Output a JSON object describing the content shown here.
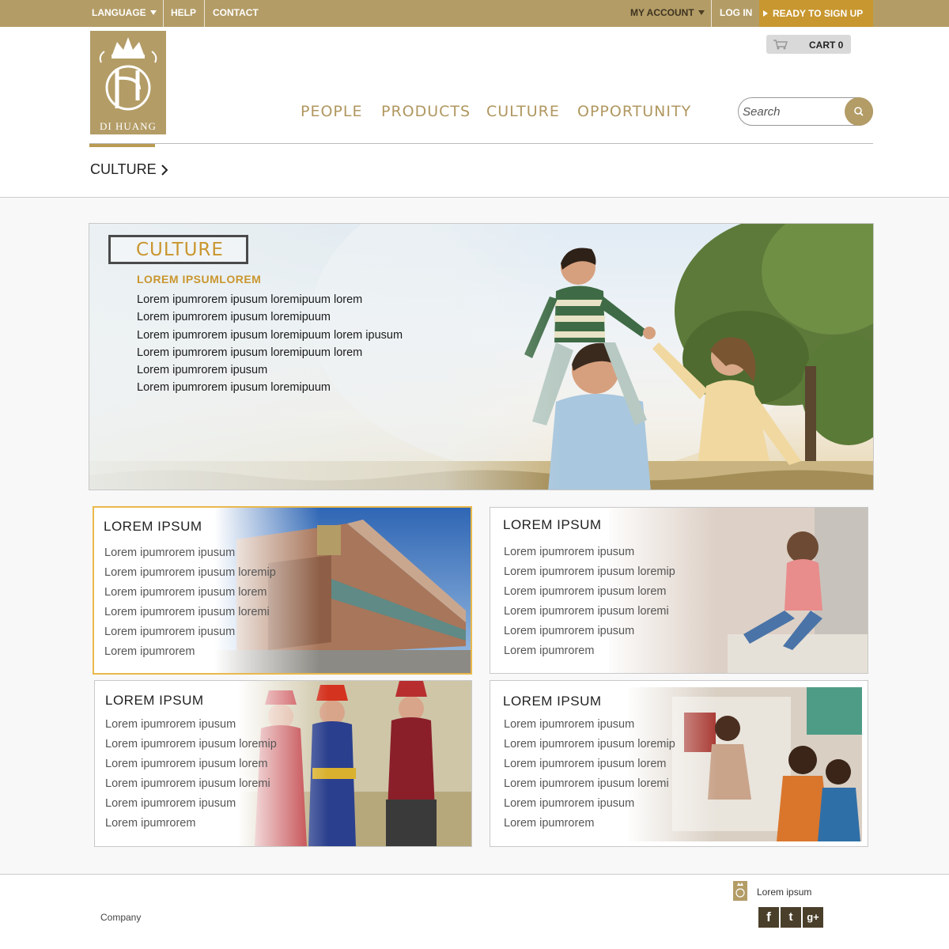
{
  "topbar": {
    "language": "LANGUAGE",
    "help": "HELP",
    "contact": "CONTACT",
    "my_account": "MY ACCOUNT",
    "login": "LOG IN",
    "signup": "READY TO SIGN UP"
  },
  "header": {
    "logo_text": "DI HUANG",
    "cart_label": "CART 0",
    "nav": [
      "PEOPLE",
      "PRODUCTS",
      "CULTURE",
      "OPPORTUNITY"
    ],
    "search_placeholder": "Search",
    "breadcrumb": "CULTURE"
  },
  "hero": {
    "title": "CULTURE",
    "subtitle": "LOREM IPSUMLOREM",
    "lines": [
      "Lorem ipumrorem ipusum loremipuum lorem",
      "Lorem ipumrorem ipusum loremipuum",
      "Lorem ipumrorem ipusum loremipuum lorem ipusum",
      "Lorem ipumrorem ipusum loremipuum lorem",
      "Lorem ipumrorem ipusum",
      "Lorem ipumrorem ipusum loremipuum"
    ]
  },
  "cards": [
    {
      "title": "LOREM IPSUM",
      "lines": [
        "Lorem ipumrorem ipusum",
        "Lorem ipumrorem ipusum loremip",
        "Lorem ipumrorem ipusum lorem",
        "Lorem ipumrorem ipusum loremi",
        "Lorem ipumrorem ipusum",
        "Lorem ipumrorem"
      ]
    },
    {
      "title": "LOREM IPSUM",
      "lines": [
        "Lorem ipumrorem ipusum",
        "Lorem ipumrorem ipusum loremip",
        "Lorem ipumrorem ipusum lorem",
        "Lorem ipumrorem ipusum loremi",
        "Lorem ipumrorem ipusum",
        "Lorem ipumrorem"
      ]
    },
    {
      "title": "LOREM IPSUM",
      "lines": [
        "Lorem ipumrorem ipusum",
        "Lorem ipumrorem ipusum loremip",
        "Lorem ipumrorem ipusum lorem",
        "Lorem ipumrorem ipusum loremi",
        "Lorem ipumrorem ipusum",
        "Lorem ipumrorem"
      ]
    },
    {
      "title": "LOREM IPSUM",
      "lines": [
        "Lorem ipumrorem ipusum",
        "Lorem ipumrorem ipusum loremip",
        "Lorem ipumrorem ipusum lorem",
        "Lorem ipumrorem ipusum loremi",
        "Lorem ipumrorem ipusum",
        "Lorem ipumrorem"
      ]
    }
  ],
  "footer": {
    "company": "Company",
    "text": "Lorem ipsum",
    "social": [
      "f",
      "t",
      "g+"
    ]
  },
  "colors": {
    "brand_gold": "#b39c66",
    "signup_bg": "#c8972f",
    "accent_text": "#c9962f",
    "active_card_border": "#eab84b"
  },
  "icons": [
    "chevron-down-icon",
    "play-arrow-icon",
    "cart-icon",
    "search-icon",
    "chevron-right-icon",
    "facebook-icon",
    "twitter-icon",
    "google-plus-icon",
    "crown-logo-icon"
  ]
}
